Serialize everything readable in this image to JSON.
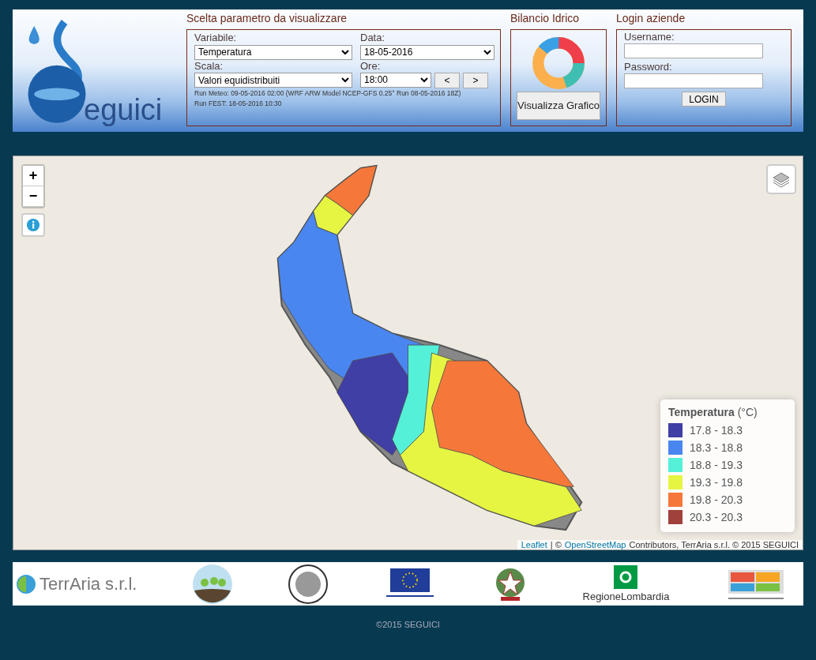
{
  "logo": {
    "text": "eguici"
  },
  "parameters": {
    "title": "Scelta parametro da visualizzare",
    "variable": {
      "label": "Variabile:",
      "value": "Temperatura"
    },
    "date": {
      "label": "Data:",
      "value": "18-05-2016"
    },
    "scale": {
      "label": "Scala:",
      "value": "Valori equidistribuiti"
    },
    "hour": {
      "label": "Ore:",
      "value": "18:00"
    },
    "prev_button": "<",
    "next_button": ">",
    "run_info": [
      "Run Meteo: 09-05-2016 02:00 (WRF ARW Model NCEP-GFS 0.25° Run 08-05-2016 18Z)",
      "Run FEST: 18-05-2016 10:30"
    ]
  },
  "water_balance": {
    "title": "Bilancio Idrico",
    "button": "Visualizza Grafico"
  },
  "login": {
    "title": "Login aziende",
    "username_label": "Username:",
    "password_label": "Password:",
    "button": "LOGIN"
  },
  "map": {
    "zoom_in": "+",
    "zoom_out": "−",
    "legend": {
      "title": "**Temperatura** (°C)",
      "items": [
        {
          "label": "17.8 - 18.3",
          "color": "#3f3fa6"
        },
        {
          "label": "18.3 - 18.8",
          "color": "#4a86f0"
        },
        {
          "label": "18.8 - 19.3",
          "color": "#55f0d8"
        },
        {
          "label": "19.3 - 19.8",
          "color": "#e6f542"
        },
        {
          "label": "19.8 - 20.3",
          "color": "#f5783a"
        },
        {
          "label": "20.3 - 20.3",
          "color": "#a0413c"
        }
      ]
    },
    "attribution": {
      "leaflet": "Leaflet",
      "separator": "| ©",
      "osm": "OpenStreetMap",
      "rest": "Contributors, TerrAria s.r.l. © 2015 SEGUICI"
    }
  },
  "partners": {
    "terraria": "TerrAria s.r.l.",
    "lombardia": "RegioneLombardia"
  },
  "copyright": "©2015 SEGUICI"
}
